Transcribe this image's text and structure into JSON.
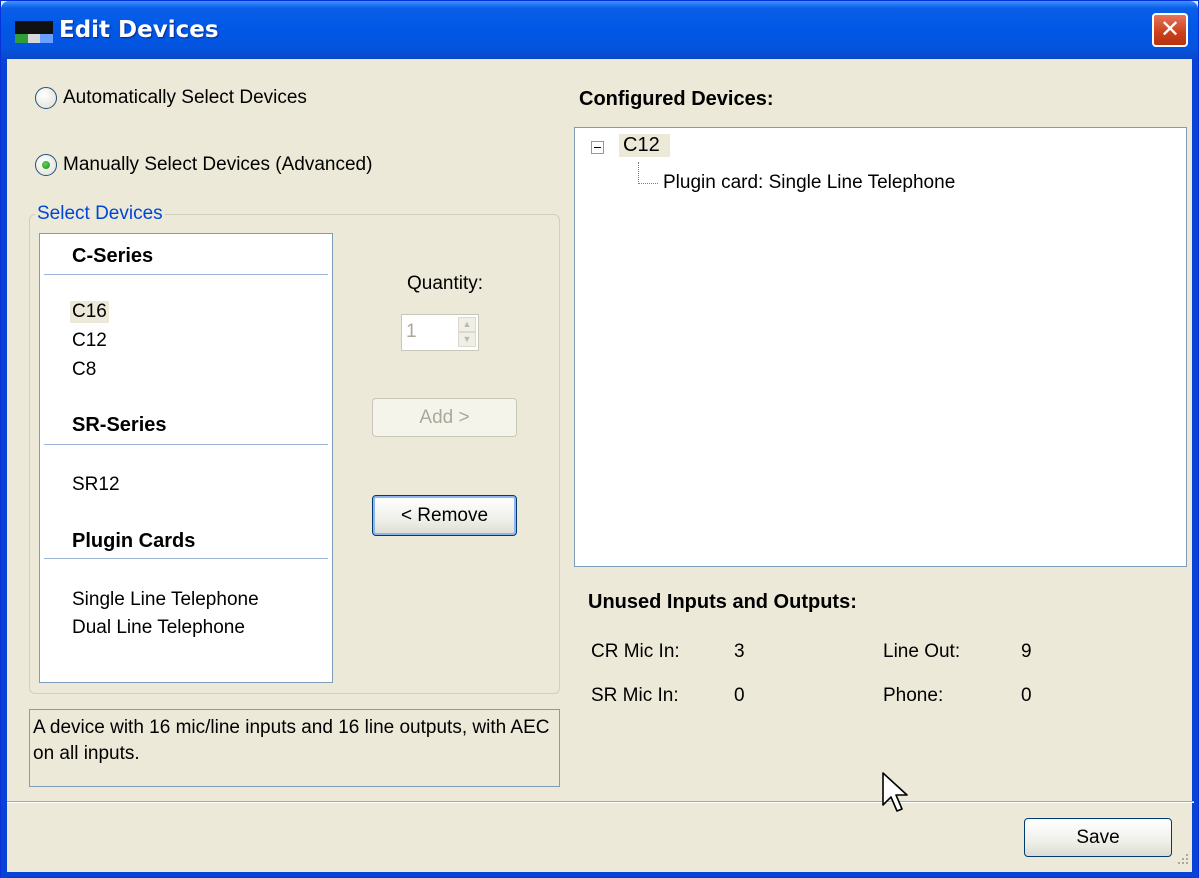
{
  "window": {
    "title": "Edit Devices",
    "close_label": "✕"
  },
  "mode": {
    "auto_label": "Automatically Select Devices",
    "manual_label": "Manually Select Devices (Advanced)",
    "selected": "manual"
  },
  "select_devices": {
    "legend": "Select Devices",
    "categories": [
      {
        "header": "C-Series",
        "items": [
          "C16",
          "C12",
          "C8"
        ]
      },
      {
        "header": "SR-Series",
        "items": [
          "SR12"
        ]
      },
      {
        "header": "Plugin Cards",
        "items": [
          "Single Line Telephone",
          "Dual Line Telephone"
        ]
      }
    ],
    "selected_item": "C16"
  },
  "quantity": {
    "label": "Quantity:",
    "value": "1"
  },
  "buttons": {
    "add_label": "Add >",
    "remove_label": "< Remove",
    "save_label": "Save"
  },
  "description": "A device with 16 mic/line inputs and 16 line outputs, with AEC on all inputs.",
  "configured": {
    "title": "Configured Devices:",
    "tree": {
      "root": "C12",
      "expanded": true,
      "children": [
        "Plugin card: Single Line Telephone"
      ]
    }
  },
  "unused": {
    "title": "Unused Inputs and Outputs:",
    "rows": [
      {
        "label1": "CR Mic In:",
        "value1": "3",
        "label2": "Line Out:",
        "value2": "9"
      },
      {
        "label1": "SR Mic In:",
        "value1": "0",
        "label2": "Phone:",
        "value2": "0"
      }
    ]
  },
  "colors": {
    "titlebar": "#0058e6",
    "window_bg": "#ece9d8",
    "legend_text": "#0046d5",
    "close_button": "#c9401c"
  }
}
